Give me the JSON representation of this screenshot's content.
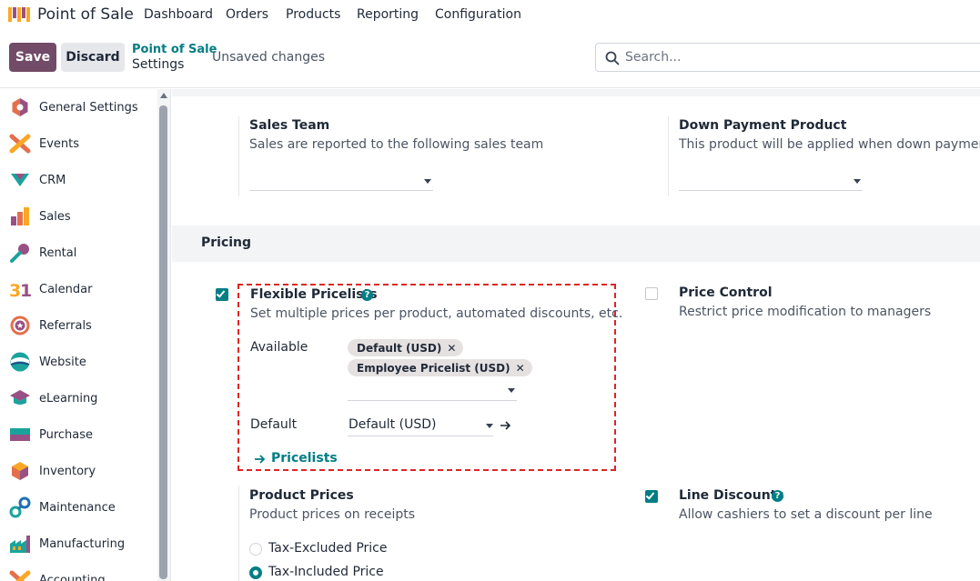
{
  "nav": {
    "app_name": "Point of Sale",
    "menu": [
      "Dashboard",
      "Orders",
      "Products",
      "Reporting",
      "Configuration"
    ]
  },
  "control": {
    "save_label": "Save",
    "discard_label": "Discard",
    "breadcrumb_parent": "Point of Sale",
    "breadcrumb_current": "Settings",
    "status": "Unsaved changes",
    "search_placeholder": "Search..."
  },
  "sidebar": {
    "items": [
      {
        "label": "General Settings",
        "icon": "general-settings-icon"
      },
      {
        "label": "Events",
        "icon": "events-icon"
      },
      {
        "label": "CRM",
        "icon": "crm-icon"
      },
      {
        "label": "Sales",
        "icon": "sales-icon"
      },
      {
        "label": "Rental",
        "icon": "rental-icon"
      },
      {
        "label": "Calendar",
        "icon": "calendar-icon"
      },
      {
        "label": "Referrals",
        "icon": "referrals-icon"
      },
      {
        "label": "Website",
        "icon": "website-icon"
      },
      {
        "label": "eLearning",
        "icon": "elearning-icon"
      },
      {
        "label": "Purchase",
        "icon": "purchase-icon"
      },
      {
        "label": "Inventory",
        "icon": "inventory-icon"
      },
      {
        "label": "Maintenance",
        "icon": "maintenance-icon"
      },
      {
        "label": "Manufacturing",
        "icon": "manufacturing-icon"
      },
      {
        "label": "Accounting",
        "icon": "accounting-icon"
      }
    ]
  },
  "settings": {
    "sales_team": {
      "title": "Sales Team",
      "desc": "Sales are reported to the following sales team"
    },
    "down_payment": {
      "title": "Down Payment Product",
      "desc": "This product will be applied when down payment is made"
    },
    "pricing_section": "Pricing",
    "flexible_pricelists": {
      "title": "Flexible Pricelists",
      "desc": "Set multiple prices per product, automated discounts, etc.",
      "enabled": true,
      "available_label": "Available",
      "tags": [
        "Default (USD)",
        "Employee Pricelist (USD)"
      ],
      "default_label": "Default",
      "default_value": "Default (USD)",
      "link_label": "Pricelists"
    },
    "price_control": {
      "title": "Price Control",
      "desc": "Restrict price modification to managers",
      "enabled": false
    },
    "product_prices": {
      "title": "Product Prices",
      "desc": "Product prices on receipts",
      "options": [
        "Tax-Excluded Price",
        "Tax-Included Price"
      ],
      "selected": "Tax-Included Price"
    },
    "line_discounts": {
      "title": "Line Discounts",
      "desc": "Allow cashiers to set a discount per line",
      "enabled": true
    }
  },
  "colors": {
    "brand": "#714B67",
    "accent": "#017e84",
    "highlight": "#dc2626"
  }
}
